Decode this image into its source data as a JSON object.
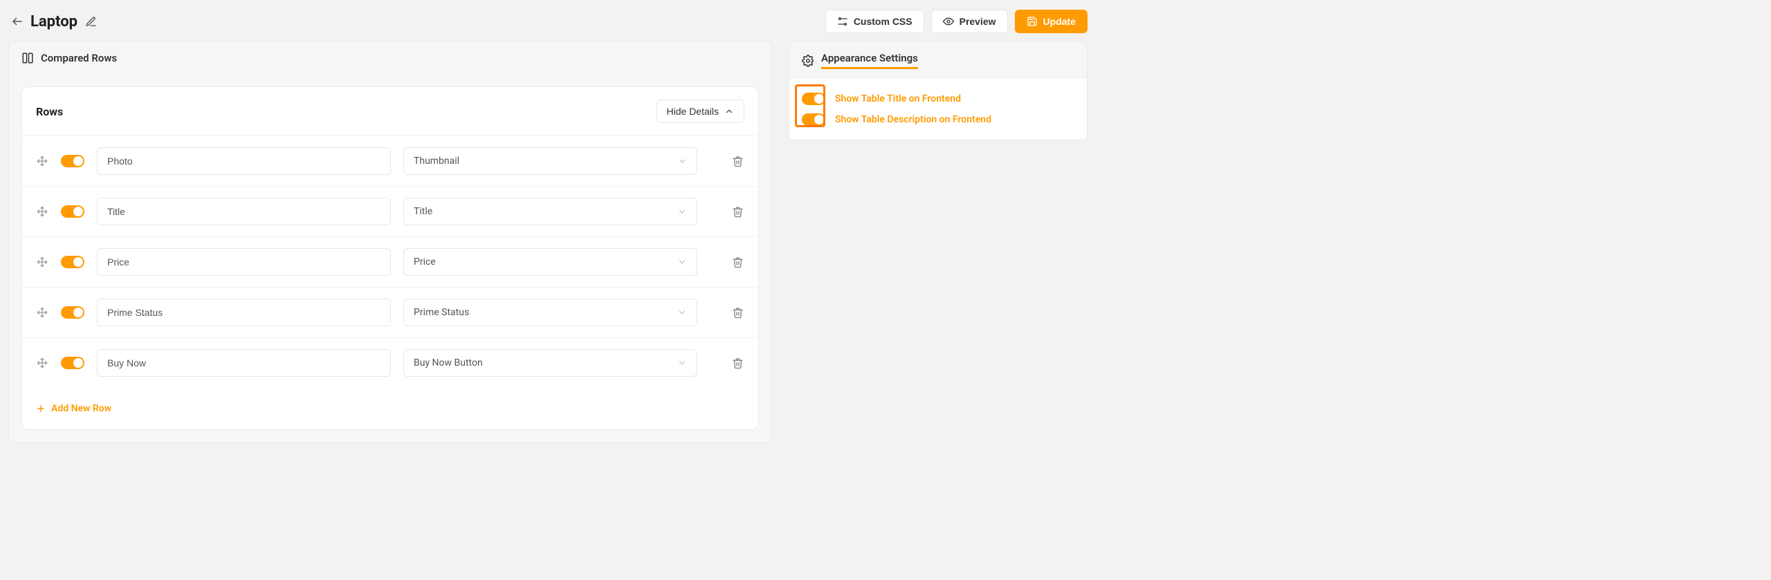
{
  "header": {
    "title": "Laptop",
    "custom_css_label": "Custom CSS",
    "preview_label": "Preview",
    "update_label": "Update"
  },
  "compared_rows_panel": {
    "label": "Compared Rows"
  },
  "rows_card": {
    "title": "Rows",
    "hide_details_label": "Hide Details",
    "add_row_label": "Add New Row",
    "rows": [
      {
        "name": "Photo",
        "type": "Thumbnail"
      },
      {
        "name": "Title",
        "type": "Title"
      },
      {
        "name": "Price",
        "type": "Price"
      },
      {
        "name": "Prime Status",
        "type": "Prime Status"
      },
      {
        "name": "Buy Now",
        "type": "Buy Now Button"
      }
    ]
  },
  "appearance_panel": {
    "label": "Appearance Settings",
    "options": [
      {
        "label": "Show Table Title on Frontend"
      },
      {
        "label": "Show Table Description on Frontend"
      }
    ]
  }
}
